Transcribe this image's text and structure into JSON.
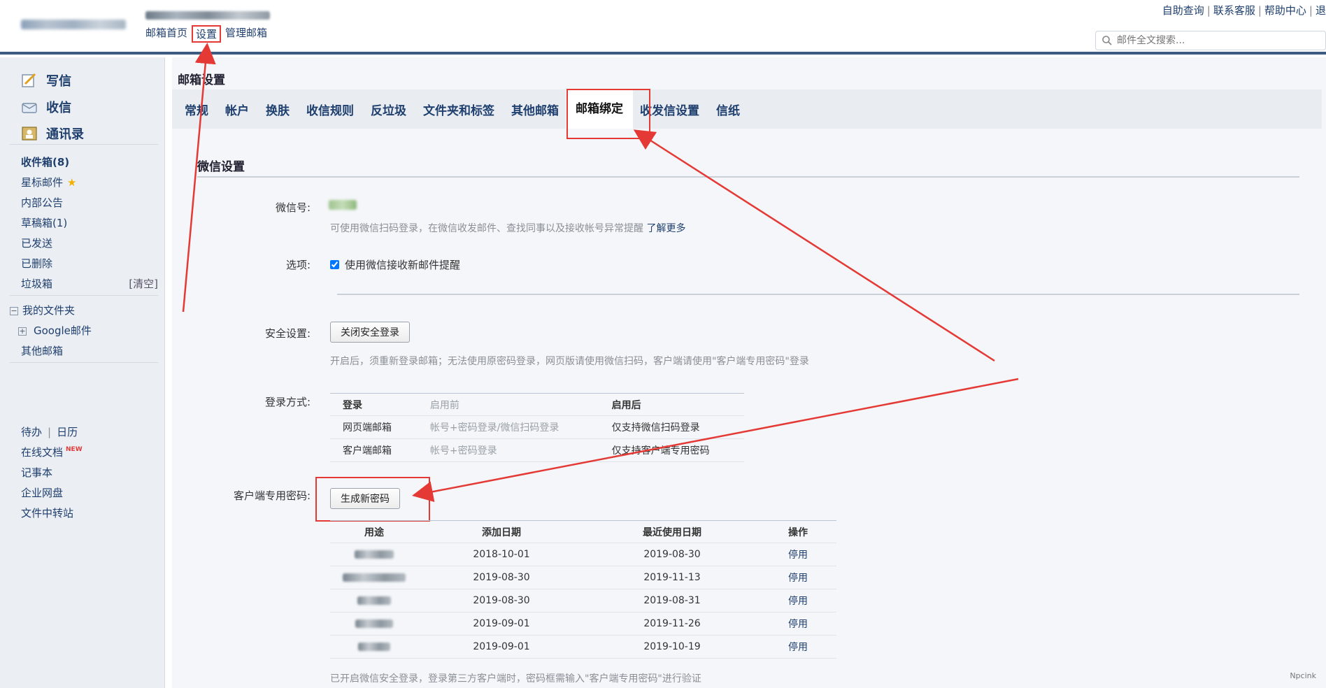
{
  "header": {
    "nav": [
      "邮箱首页",
      "设置",
      "管理邮箱"
    ],
    "right_links": [
      "自助查询",
      "联系客服",
      "帮助中心",
      "退"
    ],
    "search_placeholder": "邮件全文搜索..."
  },
  "sidebar": {
    "compose": [
      {
        "label": "写信",
        "icon": "compose-icon"
      },
      {
        "label": "收信",
        "icon": "inbox-icon"
      },
      {
        "label": "通讯录",
        "icon": "contacts-icon"
      }
    ],
    "folders": [
      {
        "label": "收件箱(8)",
        "bold": true
      },
      {
        "label": "星标邮件"
      },
      {
        "label": "内部公告"
      },
      {
        "label": "草稿箱(1)"
      },
      {
        "label": "已发送"
      },
      {
        "label": "已删除"
      },
      {
        "label": "垃圾箱",
        "extra": "[清空]"
      }
    ],
    "my_folders": "我的文件夹",
    "google_mail": "Google邮件",
    "other_mail": "其他邮箱",
    "todo": "待办",
    "calendar": "日历",
    "tools": [
      "在线文档",
      "记事本",
      "企业网盘",
      "文件中转站"
    ],
    "new_tag": "NEW"
  },
  "main": {
    "title": "邮箱设置",
    "tabs": [
      "常规",
      "帐户",
      "换肤",
      "收信规则",
      "反垃圾",
      "文件夹和标签",
      "其他邮箱",
      "邮箱绑定",
      "收发信设置",
      "信纸"
    ],
    "active_tab": "邮箱绑定",
    "section_title": "微信设置",
    "wechat_label": "微信号:",
    "wechat_desc": "可使用微信扫码登录，在微信收发邮件、查找同事以及接收帐号异常提醒",
    "learn_more": "了解更多",
    "option_label": "选项:",
    "option_checkbox": "使用微信接收新邮件提醒",
    "security_label": "安全设置:",
    "security_button": "关闭安全登录",
    "security_desc": "开启后，须重新登录邮箱；无法使用原密码登录，网页版请使用微信扫码，客户端请使用\"客户端专用密码\"登录",
    "login_label": "登录方式:",
    "login_table": {
      "headers": [
        "登录",
        "启用前",
        "启用后"
      ],
      "rows": [
        [
          "网页端邮箱",
          "帐号+密码登录/微信扫码登录",
          "仅支持微信扫码登录"
        ],
        [
          "客户端邮箱",
          "帐号+密码登录",
          "仅支持客户端专用密码"
        ]
      ]
    },
    "client_pw_label": "客户端专用密码:",
    "generate_button": "生成新密码",
    "pw_table": {
      "headers": [
        "用途",
        "添加日期",
        "最近使用日期",
        "操作"
      ],
      "rows": [
        {
          "added": "2018-10-01",
          "last": "2019-08-30",
          "op": "停用"
        },
        {
          "added": "2019-08-30",
          "last": "2019-11-13",
          "op": "停用"
        },
        {
          "added": "2019-08-30",
          "last": "2019-08-31",
          "op": "停用"
        },
        {
          "added": "2019-09-01",
          "last": "2019-11-26",
          "op": "停用"
        },
        {
          "added": "2019-09-01",
          "last": "2019-10-19",
          "op": "停用"
        }
      ]
    },
    "footnote": "已开启微信安全登录，登录第三方客户端时，密码框需输入\"客户端专用密码\"进行验证",
    "watermark": "Npcink"
  },
  "colors": {
    "annotation": "#e53935",
    "link": "#1f3f6e",
    "header_bar": "#3d5a80"
  }
}
